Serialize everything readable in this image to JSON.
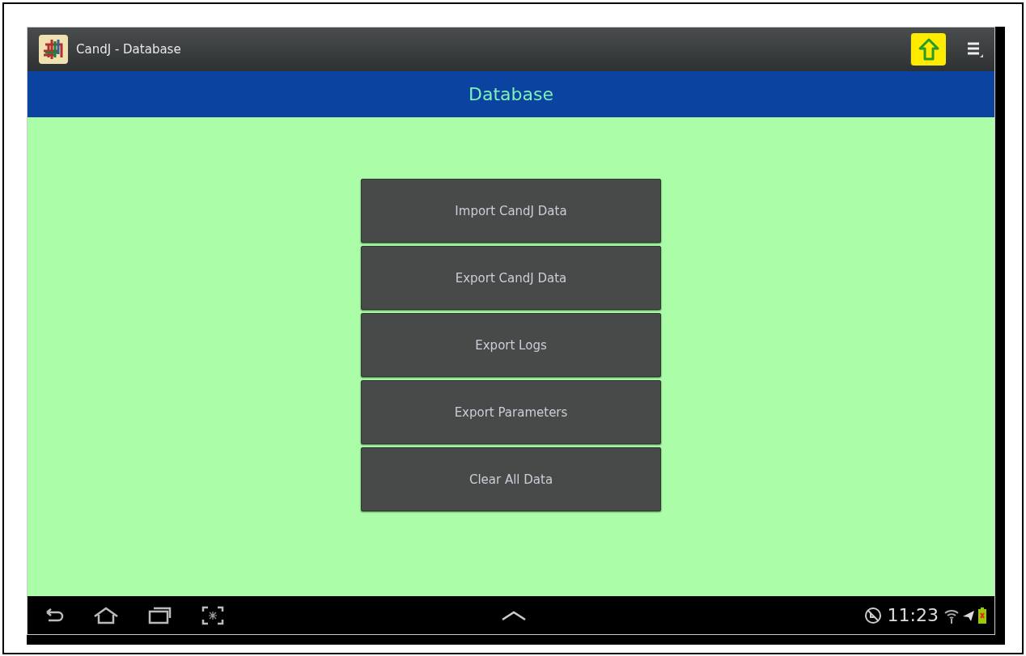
{
  "action_bar": {
    "title": "CandJ - Database"
  },
  "header": {
    "title": "Database"
  },
  "buttons": [
    {
      "label": "Import CandJ Data"
    },
    {
      "label": "Export CandJ Data"
    },
    {
      "label": "Export Logs"
    },
    {
      "label": "Export Parameters"
    },
    {
      "label": "Clear All Data"
    }
  ],
  "status_bar": {
    "time": "11:23"
  }
}
